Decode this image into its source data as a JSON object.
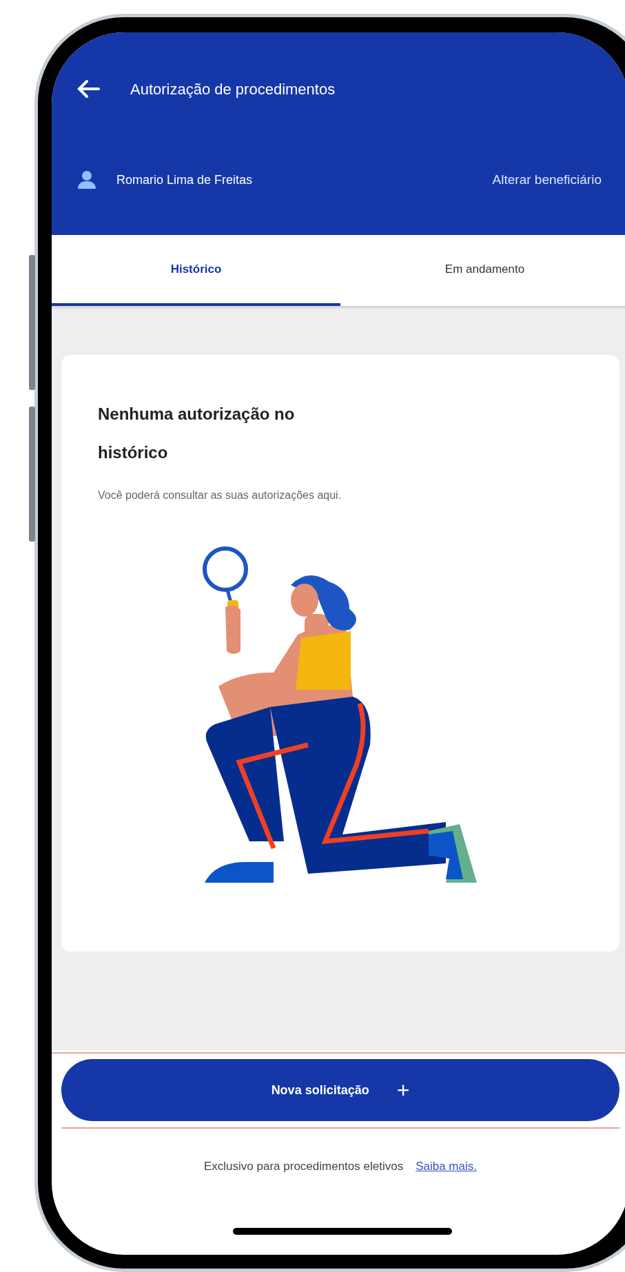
{
  "header": {
    "title": "Autorização de procedimentos",
    "beneficiary": "Romario Lima de Freitas",
    "change_link": "Alterar beneficiário"
  },
  "tabs": [
    {
      "label": "Histórico",
      "selected": true
    },
    {
      "label": "Em andamento",
      "selected": false
    }
  ],
  "empty_state": {
    "title": "Nenhuma autorização no histórico",
    "message": "Você poderá consultar as suas autorizações aqui."
  },
  "primary_button": {
    "label": "Nova solicitação",
    "icon": "+"
  },
  "footer": {
    "note": "Exclusivo para procedimentos eletivos",
    "link": "Saiba mais."
  }
}
